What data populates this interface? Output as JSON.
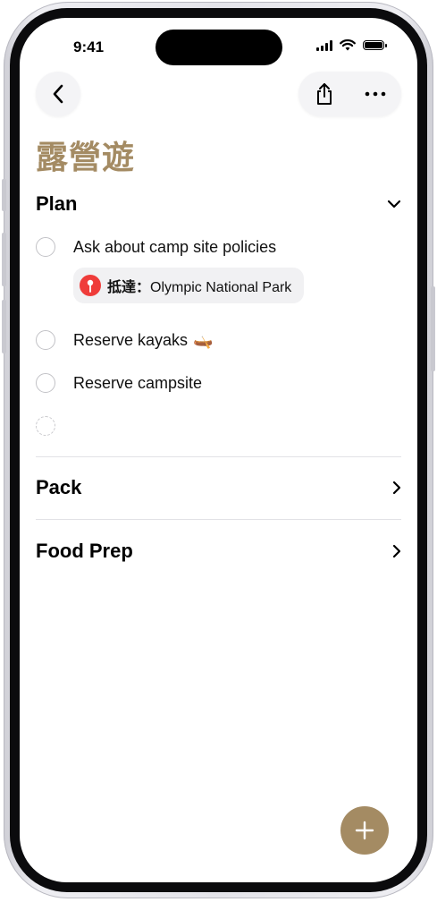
{
  "status_bar": {
    "time": "9:41"
  },
  "list": {
    "title": "露營遊"
  },
  "sections": [
    {
      "label": "Plan",
      "expanded": true,
      "tasks": [
        {
          "text": "Ask about camp site policies",
          "location_prefix": "抵達：",
          "location_name": "Olympic National Park"
        },
        {
          "text": "Reserve kayaks",
          "emoji": "🛶"
        },
        {
          "text": "Reserve campsite"
        }
      ]
    },
    {
      "label": "Pack",
      "expanded": false
    },
    {
      "label": "Food Prep",
      "expanded": false
    }
  ],
  "colors": {
    "accent": "#a48b63",
    "pin": "#ef3c3a"
  },
  "icons": [
    "back-chevron-icon",
    "share-icon",
    "more-icon",
    "chevron-down-icon",
    "chevron-right-icon",
    "location-pin-icon",
    "plus-icon"
  ]
}
